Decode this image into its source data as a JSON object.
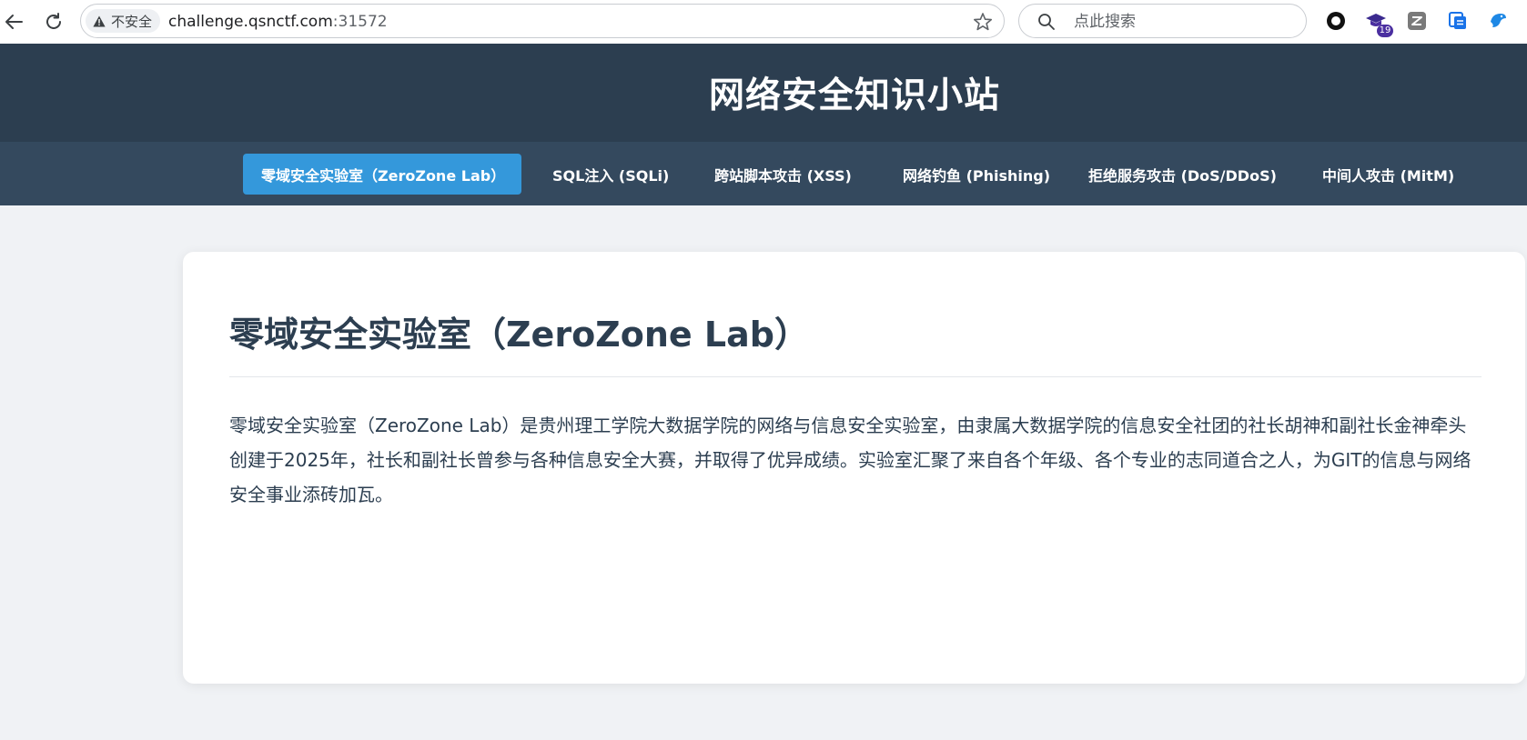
{
  "browser": {
    "security_label": "不安全",
    "url_host": "challenge.qsnctf.com",
    "url_port": ":31572",
    "search_placeholder": "点此搜索",
    "extension_badge": "19",
    "icons": [
      "back-arrow-icon",
      "reload-icon",
      "warning-icon",
      "star-icon",
      "search-icon",
      "circle-extension-icon",
      "graduation-cap-extension-icon",
      "z-extension-icon",
      "reader-extension-icon",
      "bird-extension-icon"
    ]
  },
  "site": {
    "title": "网络安全知识小站",
    "nav": [
      {
        "label": "零域安全实验室（ZeroZone Lab）",
        "active": true
      },
      {
        "label": "SQL注入 (SQLi)",
        "active": false
      },
      {
        "label": "跨站脚本攻击 (XSS)",
        "active": false
      },
      {
        "label": "网络钓鱼 (Phishing)",
        "active": false
      },
      {
        "label": "拒绝服务攻击 (DoS/DDoS)",
        "active": false
      },
      {
        "label": "中间人攻击 (MitM)",
        "active": false
      }
    ]
  },
  "content": {
    "title": "零域安全实验室（ZeroZone Lab）",
    "body": "零域安全实验室（ZeroZone Lab）是贵州理工学院大数据学院的网络与信息安全实验室，由隶属大数据学院的信息安全社团的社长胡神和副社长金神牵头创建于2025年，社长和副社长曾参与各种信息安全大赛，并取得了优异成绩。实验室汇聚了来自各个年级、各个专业的志同道合之人，为GIT的信息与网络安全事业添砖加瓦。"
  },
  "colors": {
    "header_bg": "#2c3e50",
    "nav_bg": "#34495e",
    "active_nav": "#3498db",
    "page_bg": "#f0f2f5",
    "text": "#2c3e50"
  }
}
